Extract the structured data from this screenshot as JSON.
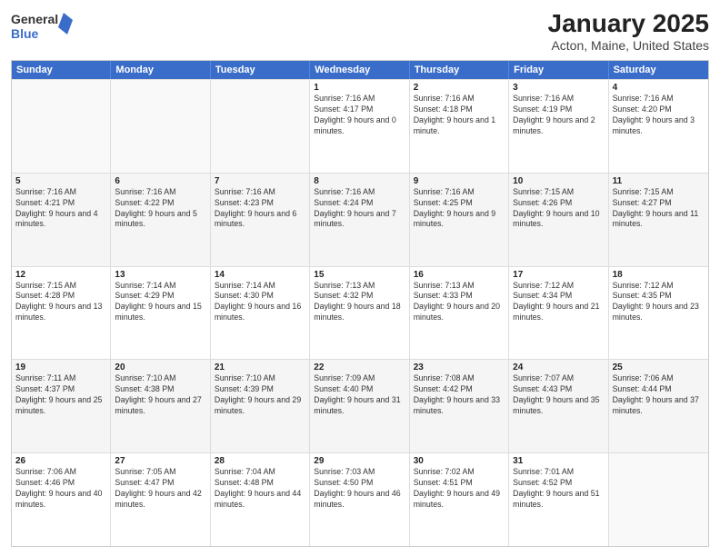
{
  "header": {
    "logo": {
      "line1": "General",
      "line2": "Blue"
    },
    "title": "January 2025",
    "subtitle": "Acton, Maine, United States"
  },
  "days_of_week": [
    "Sunday",
    "Monday",
    "Tuesday",
    "Wednesday",
    "Thursday",
    "Friday",
    "Saturday"
  ],
  "weeks": [
    [
      {
        "day": "",
        "sunrise": "",
        "sunset": "",
        "daylight": ""
      },
      {
        "day": "",
        "sunrise": "",
        "sunset": "",
        "daylight": ""
      },
      {
        "day": "",
        "sunrise": "",
        "sunset": "",
        "daylight": ""
      },
      {
        "day": "1",
        "sunrise": "Sunrise: 7:16 AM",
        "sunset": "Sunset: 4:17 PM",
        "daylight": "Daylight: 9 hours and 0 minutes."
      },
      {
        "day": "2",
        "sunrise": "Sunrise: 7:16 AM",
        "sunset": "Sunset: 4:18 PM",
        "daylight": "Daylight: 9 hours and 1 minute."
      },
      {
        "day": "3",
        "sunrise": "Sunrise: 7:16 AM",
        "sunset": "Sunset: 4:19 PM",
        "daylight": "Daylight: 9 hours and 2 minutes."
      },
      {
        "day": "4",
        "sunrise": "Sunrise: 7:16 AM",
        "sunset": "Sunset: 4:20 PM",
        "daylight": "Daylight: 9 hours and 3 minutes."
      }
    ],
    [
      {
        "day": "5",
        "sunrise": "Sunrise: 7:16 AM",
        "sunset": "Sunset: 4:21 PM",
        "daylight": "Daylight: 9 hours and 4 minutes."
      },
      {
        "day": "6",
        "sunrise": "Sunrise: 7:16 AM",
        "sunset": "Sunset: 4:22 PM",
        "daylight": "Daylight: 9 hours and 5 minutes."
      },
      {
        "day": "7",
        "sunrise": "Sunrise: 7:16 AM",
        "sunset": "Sunset: 4:23 PM",
        "daylight": "Daylight: 9 hours and 6 minutes."
      },
      {
        "day": "8",
        "sunrise": "Sunrise: 7:16 AM",
        "sunset": "Sunset: 4:24 PM",
        "daylight": "Daylight: 9 hours and 7 minutes."
      },
      {
        "day": "9",
        "sunrise": "Sunrise: 7:16 AM",
        "sunset": "Sunset: 4:25 PM",
        "daylight": "Daylight: 9 hours and 9 minutes."
      },
      {
        "day": "10",
        "sunrise": "Sunrise: 7:15 AM",
        "sunset": "Sunset: 4:26 PM",
        "daylight": "Daylight: 9 hours and 10 minutes."
      },
      {
        "day": "11",
        "sunrise": "Sunrise: 7:15 AM",
        "sunset": "Sunset: 4:27 PM",
        "daylight": "Daylight: 9 hours and 11 minutes."
      }
    ],
    [
      {
        "day": "12",
        "sunrise": "Sunrise: 7:15 AM",
        "sunset": "Sunset: 4:28 PM",
        "daylight": "Daylight: 9 hours and 13 minutes."
      },
      {
        "day": "13",
        "sunrise": "Sunrise: 7:14 AM",
        "sunset": "Sunset: 4:29 PM",
        "daylight": "Daylight: 9 hours and 15 minutes."
      },
      {
        "day": "14",
        "sunrise": "Sunrise: 7:14 AM",
        "sunset": "Sunset: 4:30 PM",
        "daylight": "Daylight: 9 hours and 16 minutes."
      },
      {
        "day": "15",
        "sunrise": "Sunrise: 7:13 AM",
        "sunset": "Sunset: 4:32 PM",
        "daylight": "Daylight: 9 hours and 18 minutes."
      },
      {
        "day": "16",
        "sunrise": "Sunrise: 7:13 AM",
        "sunset": "Sunset: 4:33 PM",
        "daylight": "Daylight: 9 hours and 20 minutes."
      },
      {
        "day": "17",
        "sunrise": "Sunrise: 7:12 AM",
        "sunset": "Sunset: 4:34 PM",
        "daylight": "Daylight: 9 hours and 21 minutes."
      },
      {
        "day": "18",
        "sunrise": "Sunrise: 7:12 AM",
        "sunset": "Sunset: 4:35 PM",
        "daylight": "Daylight: 9 hours and 23 minutes."
      }
    ],
    [
      {
        "day": "19",
        "sunrise": "Sunrise: 7:11 AM",
        "sunset": "Sunset: 4:37 PM",
        "daylight": "Daylight: 9 hours and 25 minutes."
      },
      {
        "day": "20",
        "sunrise": "Sunrise: 7:10 AM",
        "sunset": "Sunset: 4:38 PM",
        "daylight": "Daylight: 9 hours and 27 minutes."
      },
      {
        "day": "21",
        "sunrise": "Sunrise: 7:10 AM",
        "sunset": "Sunset: 4:39 PM",
        "daylight": "Daylight: 9 hours and 29 minutes."
      },
      {
        "day": "22",
        "sunrise": "Sunrise: 7:09 AM",
        "sunset": "Sunset: 4:40 PM",
        "daylight": "Daylight: 9 hours and 31 minutes."
      },
      {
        "day": "23",
        "sunrise": "Sunrise: 7:08 AM",
        "sunset": "Sunset: 4:42 PM",
        "daylight": "Daylight: 9 hours and 33 minutes."
      },
      {
        "day": "24",
        "sunrise": "Sunrise: 7:07 AM",
        "sunset": "Sunset: 4:43 PM",
        "daylight": "Daylight: 9 hours and 35 minutes."
      },
      {
        "day": "25",
        "sunrise": "Sunrise: 7:06 AM",
        "sunset": "Sunset: 4:44 PM",
        "daylight": "Daylight: 9 hours and 37 minutes."
      }
    ],
    [
      {
        "day": "26",
        "sunrise": "Sunrise: 7:06 AM",
        "sunset": "Sunset: 4:46 PM",
        "daylight": "Daylight: 9 hours and 40 minutes."
      },
      {
        "day": "27",
        "sunrise": "Sunrise: 7:05 AM",
        "sunset": "Sunset: 4:47 PM",
        "daylight": "Daylight: 9 hours and 42 minutes."
      },
      {
        "day": "28",
        "sunrise": "Sunrise: 7:04 AM",
        "sunset": "Sunset: 4:48 PM",
        "daylight": "Daylight: 9 hours and 44 minutes."
      },
      {
        "day": "29",
        "sunrise": "Sunrise: 7:03 AM",
        "sunset": "Sunset: 4:50 PM",
        "daylight": "Daylight: 9 hours and 46 minutes."
      },
      {
        "day": "30",
        "sunrise": "Sunrise: 7:02 AM",
        "sunset": "Sunset: 4:51 PM",
        "daylight": "Daylight: 9 hours and 49 minutes."
      },
      {
        "day": "31",
        "sunrise": "Sunrise: 7:01 AM",
        "sunset": "Sunset: 4:52 PM",
        "daylight": "Daylight: 9 hours and 51 minutes."
      },
      {
        "day": "",
        "sunrise": "",
        "sunset": "",
        "daylight": ""
      }
    ]
  ]
}
